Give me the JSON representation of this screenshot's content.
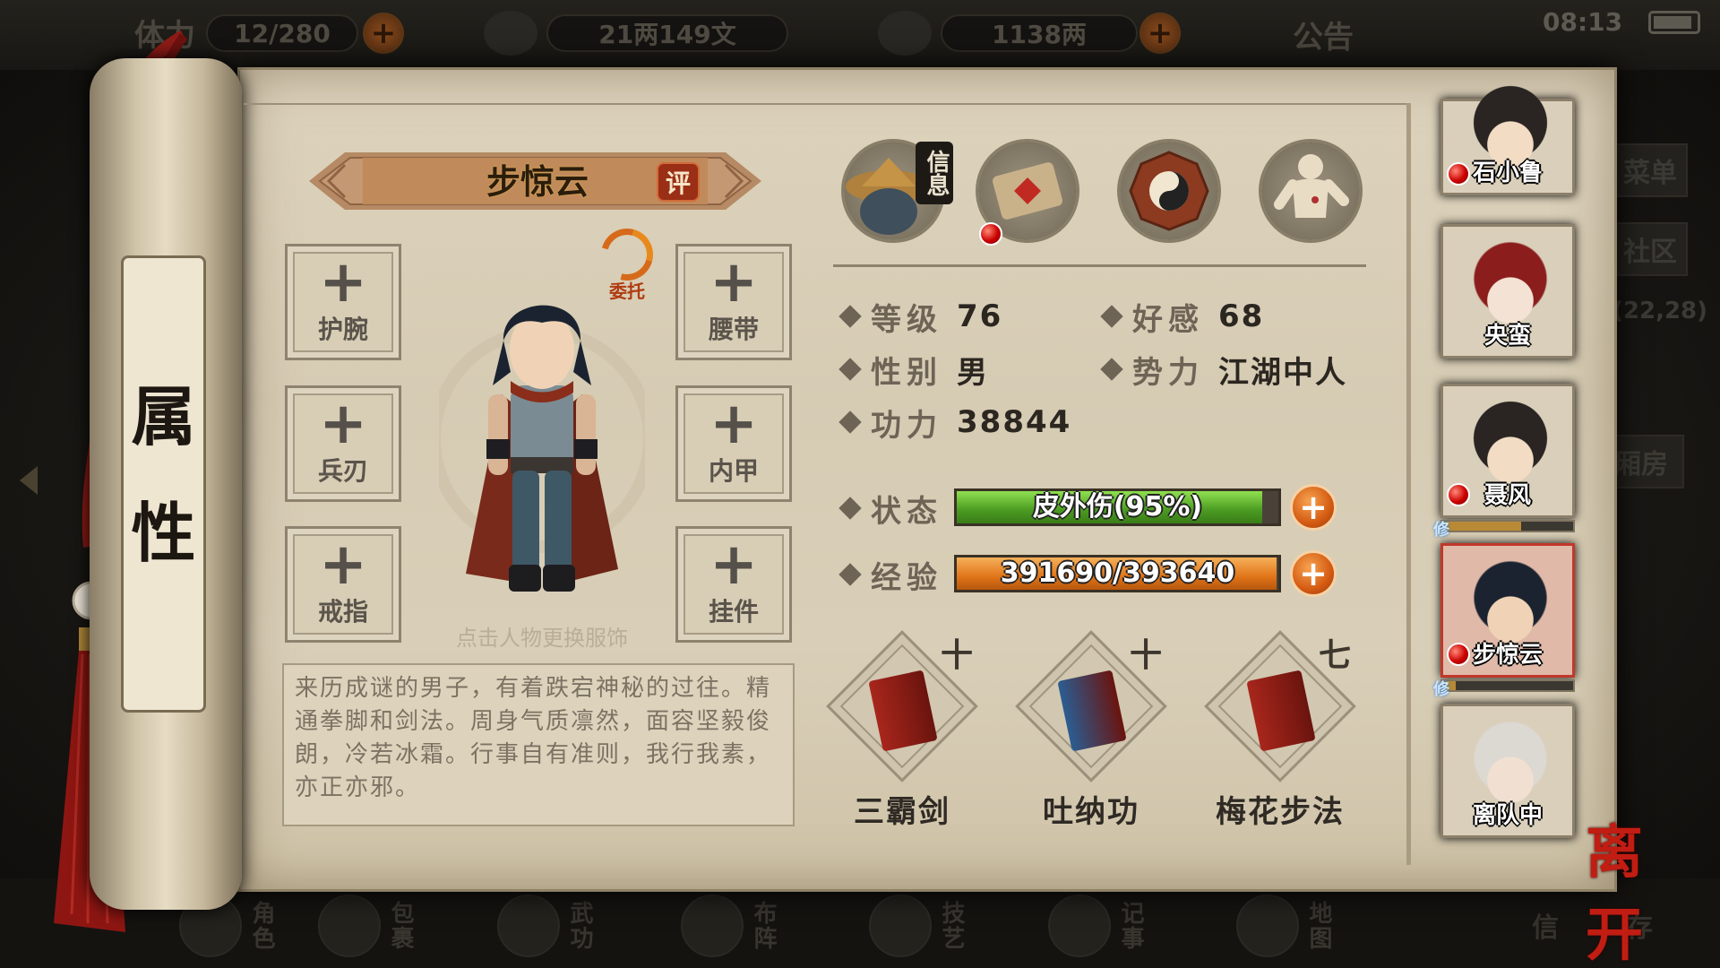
{
  "topbar": {
    "stamina_label": "体力",
    "stamina_value": "12/280",
    "silver": "21两149文",
    "gold": "1138两",
    "notice_label": "公告",
    "time": "08:13"
  },
  "bg_menu": {
    "menu_label": "菜单",
    "community_label": "社区",
    "coords": "(22,28)",
    "room_label": "厢房"
  },
  "bottom_nav": [
    "角色",
    "包裹",
    "武功",
    "布阵",
    "技艺",
    "记事",
    "地图",
    "信",
    "存"
  ],
  "scroll_title": "属性",
  "character": {
    "name": "步惊云",
    "comment_badge": "评",
    "entrust_label": "委托",
    "change_outfit_hint": "点击人物更换服饰",
    "description": "来历成谜的男子，有着跌宕神秘的过往。精通拳脚和剑法。周身气质凛然，面容坚毅俊朗，冷若冰霜。行事自有准则，我行我素，亦正亦邪。"
  },
  "equipment": {
    "wrist": "护腕",
    "belt": "腰带",
    "weapon": "兵刃",
    "armor": "内甲",
    "ring": "戒指",
    "pendant": "挂件"
  },
  "tabs": {
    "info_label": "信息"
  },
  "stats": {
    "level_label": "等级",
    "level": "76",
    "favor_label": "好感",
    "favor": "68",
    "gender_label": "性别",
    "gender": "男",
    "faction_label": "势力",
    "faction": "江湖中人",
    "power_label": "功力",
    "power": "38844",
    "status_label": "状态",
    "status_text": "皮外伤(95%)",
    "status_fill": 0.95,
    "exp_label": "经验",
    "exp_text": "391690/393640",
    "exp_fill": 0.995
  },
  "skills": [
    {
      "name": "三霸剑",
      "level": "十",
      "book_color": "#a8261c"
    },
    {
      "name": "吐纳功",
      "level": "十",
      "book_color": "#2b5d92"
    },
    {
      "name": "梅花步法",
      "level": "七",
      "book_color": "#a8261c"
    }
  ],
  "companions": [
    {
      "name": "石小鲁"
    },
    {
      "name": "央蛮"
    },
    {
      "name": "聂风",
      "progress": 0.6,
      "xiu": "修"
    },
    {
      "name": "步惊云",
      "progress": 0.1,
      "xiu": "修"
    },
    {
      "name": "离队中"
    }
  ],
  "leave_label": "离开",
  "colors": {
    "status_green": "#59b52c",
    "exp_orange": "#e6801a",
    "accent_red": "#c11d13"
  }
}
